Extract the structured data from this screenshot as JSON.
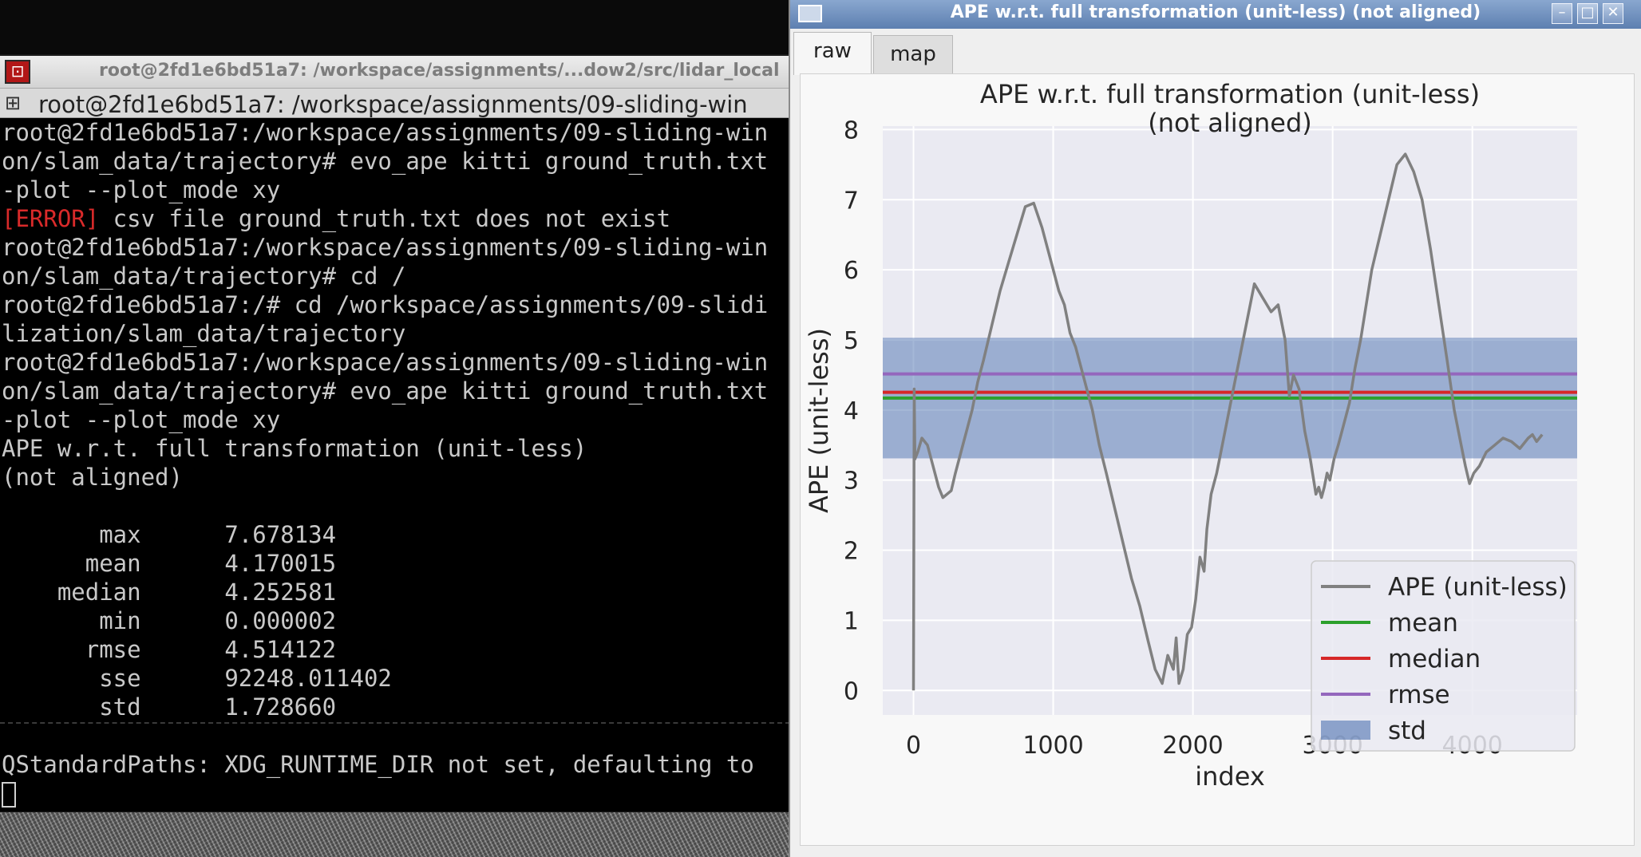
{
  "terminal": {
    "window_title": "root@2fd1e6bd51a7: /workspace/assignments/...dow2/src/lidar_local",
    "tab_title": "root@2fd1e6bd51a7: /workspace/assignments/09-sliding-win",
    "lines": [
      {
        "pre": "",
        "err": "",
        "post": "root@2fd1e6bd51a7:/workspace/assignments/09-sliding-win"
      },
      {
        "pre": "",
        "err": "",
        "post": "on/slam_data/trajectory# evo_ape kitti ground_truth.txt"
      },
      {
        "pre": "",
        "err": "",
        "post": "-plot --plot_mode xy"
      },
      {
        "pre": "",
        "err": "[ERROR]",
        "post": " csv file ground_truth.txt does not exist"
      },
      {
        "pre": "",
        "err": "",
        "post": "root@2fd1e6bd51a7:/workspace/assignments/09-sliding-win"
      },
      {
        "pre": "",
        "err": "",
        "post": "on/slam_data/trajectory# cd /"
      },
      {
        "pre": "",
        "err": "",
        "post": "root@2fd1e6bd51a7:/# cd /workspace/assignments/09-slidi"
      },
      {
        "pre": "",
        "err": "",
        "post": "lization/slam_data/trajectory"
      },
      {
        "pre": "",
        "err": "",
        "post": "root@2fd1e6bd51a7:/workspace/assignments/09-sliding-win"
      },
      {
        "pre": "",
        "err": "",
        "post": "on/slam_data/trajectory# evo_ape kitti ground_truth.txt"
      },
      {
        "pre": "",
        "err": "",
        "post": "-plot --plot_mode xy"
      },
      {
        "pre": "",
        "err": "",
        "post": "APE w.r.t. full transformation (unit-less)"
      },
      {
        "pre": "",
        "err": "",
        "post": "(not aligned)"
      },
      {
        "pre": "",
        "err": "",
        "post": ""
      },
      {
        "pre": "",
        "err": "",
        "post": "       max      7.678134"
      },
      {
        "pre": "",
        "err": "",
        "post": "      mean      4.170015"
      },
      {
        "pre": "",
        "err": "",
        "post": "    median      4.252581"
      },
      {
        "pre": "",
        "err": "",
        "post": "       min      0.000002"
      },
      {
        "pre": "",
        "err": "",
        "post": "      rmse      4.514122"
      },
      {
        "pre": "",
        "err": "",
        "post": "       sse      92248.011402"
      },
      {
        "pre": "",
        "err": "",
        "post": "       std      1.728660"
      },
      {
        "pre": "",
        "err": "",
        "post": ""
      },
      {
        "pre": "",
        "err": "",
        "post": "QStandardPaths: XDG_RUNTIME_DIR not set, defaulting to"
      }
    ]
  },
  "plot_window": {
    "title": "APE w.r.t. full transformation (unit-less) (not aligned)",
    "tabs": [
      "raw",
      "map"
    ],
    "active_tab": "raw",
    "buttons": [
      "minimize-icon",
      "maximize-icon",
      "close-icon"
    ]
  },
  "chart_data": {
    "type": "line",
    "title": "APE w.r.t. full transformation (unit-less)",
    "subtitle": "(not aligned)",
    "xlabel": "index",
    "ylabel": "APE (unit-less)",
    "xlim": [
      -220,
      4750
    ],
    "ylim": [
      -0.35,
      8.05
    ],
    "xticks": [
      0,
      1000,
      2000,
      3000,
      4000
    ],
    "yticks": [
      0,
      1,
      2,
      3,
      4,
      5,
      6,
      7,
      8
    ],
    "grid": true,
    "legend_position": "lower-right",
    "series": [
      {
        "name": "APE (unit-less)",
        "color": "#808080",
        "x": [
          0,
          5,
          10,
          30,
          60,
          100,
          140,
          180,
          210,
          240,
          270,
          300,
          340,
          380,
          420,
          460,
          500,
          560,
          620,
          680,
          740,
          800,
          860,
          920,
          960,
          1000,
          1040,
          1080,
          1120,
          1160,
          1200,
          1240,
          1280,
          1330,
          1380,
          1440,
          1500,
          1560,
          1620,
          1680,
          1730,
          1780,
          1820,
          1860,
          1880,
          1900,
          1930,
          1960,
          1990,
          2020,
          2050,
          2080,
          2100,
          2130,
          2170,
          2210,
          2260,
          2320,
          2380,
          2440,
          2500,
          2560,
          2610,
          2660,
          2690,
          2720,
          2760,
          2800,
          2840,
          2880,
          2900,
          2920,
          2940,
          2960,
          2980,
          3010,
          3040,
          3080,
          3120,
          3160,
          3200,
          3240,
          3280,
          3340,
          3400,
          3460,
          3520,
          3580,
          3640,
          3700,
          3760,
          3820,
          3870,
          3920,
          3950,
          3980,
          4010,
          4050,
          4100,
          4160,
          4220,
          4280,
          4340,
          4400,
          4430,
          4460,
          4480,
          4500
        ],
        "y": [
          0.0,
          4.3,
          3.3,
          3.4,
          3.6,
          3.5,
          3.2,
          2.9,
          2.75,
          2.8,
          2.85,
          3.1,
          3.4,
          3.7,
          4.0,
          4.4,
          4.7,
          5.2,
          5.7,
          6.1,
          6.5,
          6.9,
          6.95,
          6.6,
          6.3,
          6.0,
          5.7,
          5.5,
          5.1,
          4.9,
          4.6,
          4.3,
          4.0,
          3.5,
          3.1,
          2.6,
          2.1,
          1.6,
          1.2,
          0.7,
          0.3,
          0.1,
          0.5,
          0.3,
          0.75,
          0.1,
          0.3,
          0.8,
          0.9,
          1.3,
          1.9,
          1.7,
          2.3,
          2.8,
          3.1,
          3.5,
          4.0,
          4.6,
          5.2,
          5.8,
          5.6,
          5.4,
          5.5,
          5.0,
          4.2,
          4.5,
          4.3,
          3.7,
          3.3,
          2.8,
          2.9,
          2.75,
          2.9,
          3.1,
          3.0,
          3.3,
          3.5,
          3.8,
          4.1,
          4.6,
          5.0,
          5.5,
          6.0,
          6.5,
          7.0,
          7.5,
          7.65,
          7.4,
          7.0,
          6.3,
          5.5,
          4.7,
          4.0,
          3.5,
          3.2,
          2.95,
          3.1,
          3.2,
          3.4,
          3.5,
          3.6,
          3.55,
          3.45,
          3.6,
          3.65,
          3.55,
          3.6,
          3.65
        ]
      },
      {
        "name": "mean",
        "color": "#2ca02c",
        "value": 4.170015
      },
      {
        "name": "median",
        "color": "#d62728",
        "value": 4.252581
      },
      {
        "name": "rmse",
        "color": "#9467bd",
        "value": 4.514122
      },
      {
        "name": "std",
        "color": "#4c72b0",
        "range": [
          3.31,
          5.03
        ]
      }
    ],
    "legend": [
      "APE (unit-less)",
      "mean",
      "median",
      "rmse",
      "std"
    ]
  }
}
